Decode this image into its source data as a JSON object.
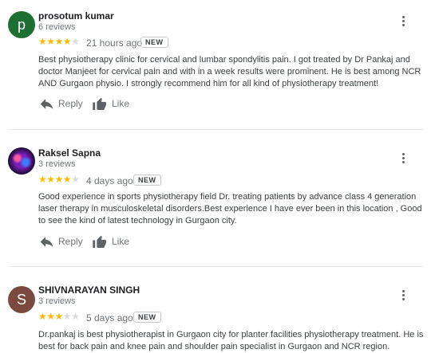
{
  "reviews": [
    {
      "avatar_letter": "p",
      "avatar_color": "#1e6f34",
      "name": "prosotum kumar",
      "review_count": "6 reviews",
      "rating": 4,
      "time": "21 hours ago",
      "badge": "NEW",
      "text": "Best physiotherapy clinic for cervical and lumbar spondylitis pain. I got treated by Dr Pankaj and doctor Manjeet for cervical pain and with in a week results were prominent. He is best among NCR AND Gurgaon physio. I strongly recommend him for all kind of physiotherapy treatment!",
      "reply_label": "Reply",
      "like_label": "Like"
    },
    {
      "avatar_letter": "",
      "avatar_color": "#2a0f4a",
      "name": "Raksel Sapna",
      "review_count": "3 reviews",
      "rating": 4,
      "time": "4 days ago",
      "badge": "NEW",
      "text": "Good experience in sports physiotherapy field Dr. treating patients by advance class 4 generation laser therapy in musculoskeletal disorders.Best experience I have ever been in this location , Good to see the kind of latest technology in Gurgaon city.",
      "reply_label": "Reply",
      "like_label": "Like"
    },
    {
      "avatar_letter": "S",
      "avatar_color": "#7b4a3e",
      "name": "SHIVNARAYAN SINGH",
      "review_count": "3 reviews",
      "rating": 3,
      "time": "5 days ago",
      "badge": "NEW",
      "text": "Dr.pankaj is best physiotherapist in Gurgaon city for planter facilities physiotherapy treatment. He is best for back pain and knee pain and shoulder pain specialist in Gurgaon and NCR region.",
      "reply_label": "",
      "like_label": ""
    }
  ]
}
